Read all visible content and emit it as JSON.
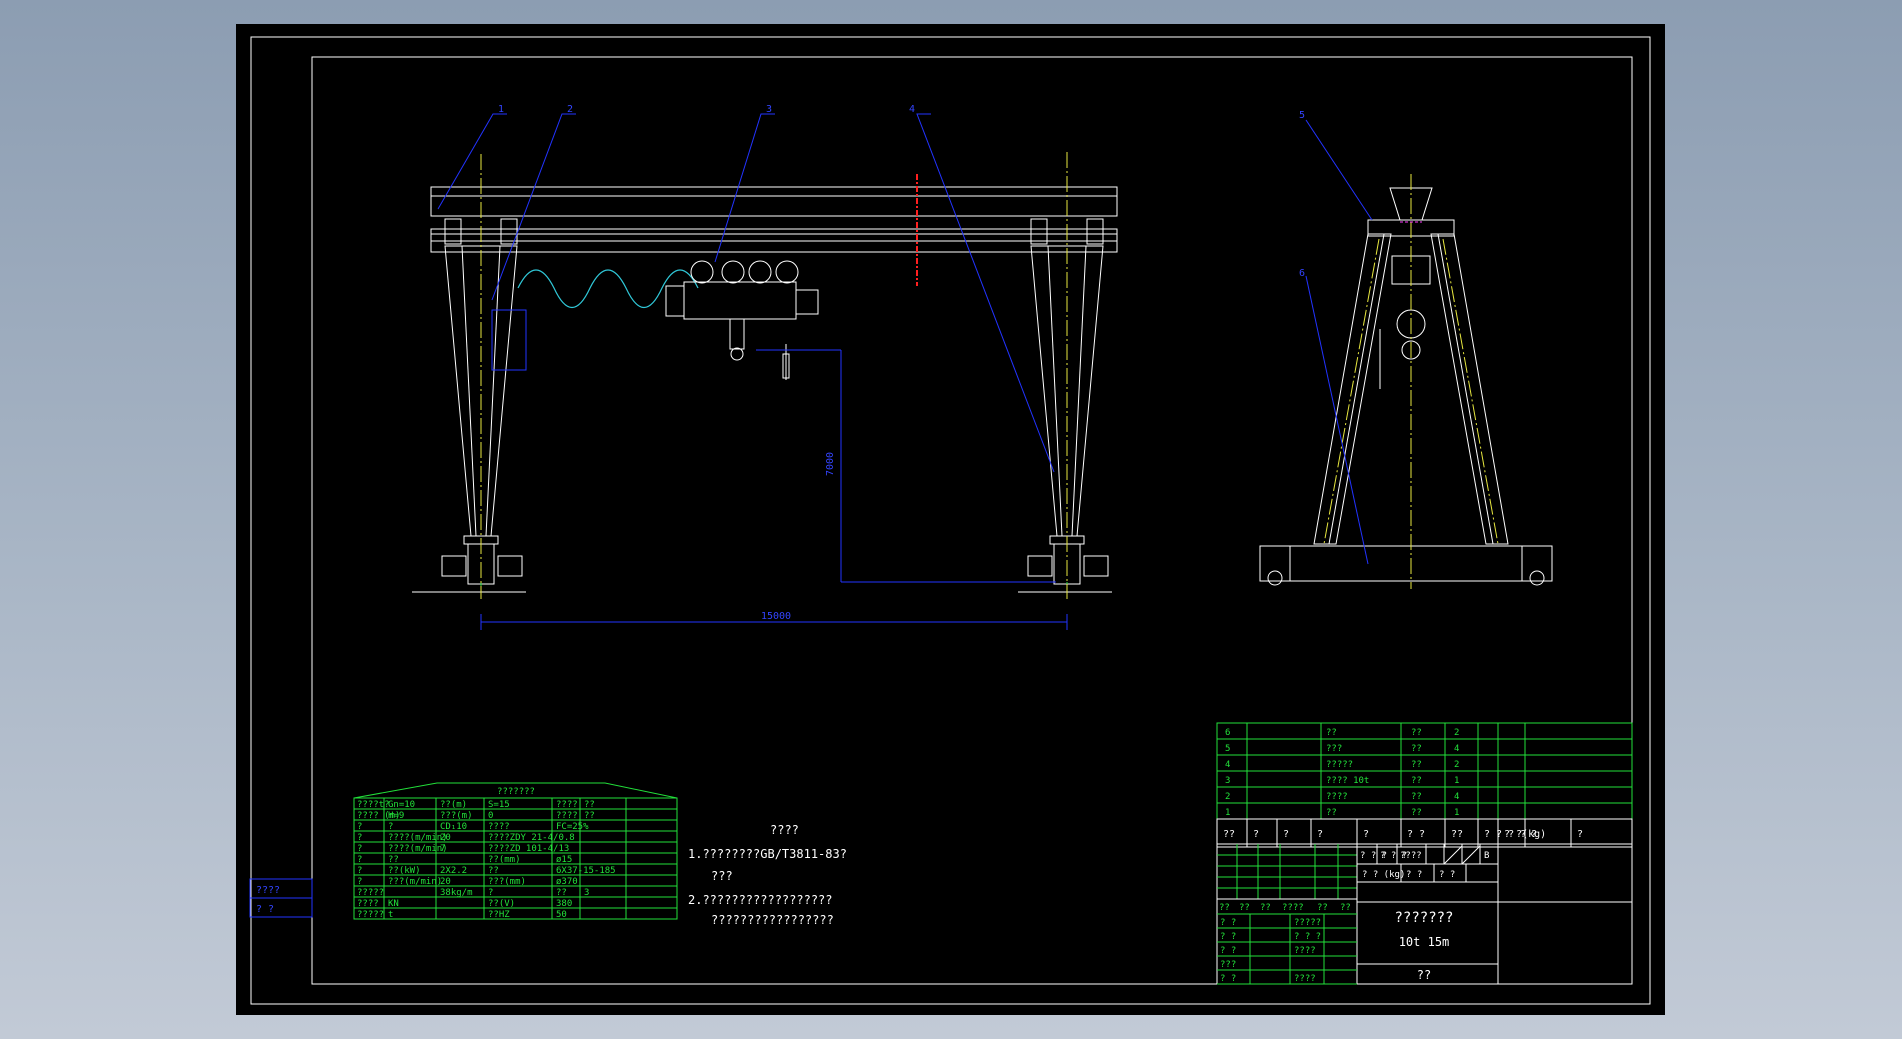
{
  "drawing": {
    "part_numbers": [
      "1",
      "2",
      "3",
      "4",
      "5",
      "6"
    ],
    "dim_span": "15000",
    "dim_height": "7000"
  },
  "notes": {
    "heading": "????",
    "line1": "1.????????GB/T3811-83?",
    "line2": "???",
    "line3": "2.??????????????????",
    "line4": "?????????????????"
  },
  "spec_table": {
    "title": "???????",
    "rows": [
      [
        "????t?",
        "Gn=10",
        "??(m)",
        "S=15",
        "????",
        "??"
      ],
      [
        "???? (m)",
        "H=9",
        "???(m)",
        "0",
        "????",
        "??"
      ],
      [
        "?",
        "?",
        "CD₁10",
        "????",
        "FC=25%",
        ""
      ],
      [
        "?",
        "????(m/min)",
        "20",
        "????ZDY 21-4/0.8",
        "",
        ""
      ],
      [
        "?",
        "????(m/min)",
        "7",
        "????ZD 101-4/13",
        "",
        ""
      ],
      [
        "?",
        "??",
        "",
        "??(mm)",
        "ø15",
        ""
      ],
      [
        "?",
        "??(kW)",
        "2X2.2",
        "??",
        "6X37-15-185",
        ""
      ],
      [
        "?",
        "???(m/min)",
        "20",
        "???(mm)",
        "ø370",
        ""
      ],
      [
        "?????",
        "",
        "38kg/m",
        "?",
        "??",
        "3"
      ],
      [
        "????",
        "KN",
        "",
        "??(V)",
        "380",
        ""
      ],
      [
        "?????",
        "t",
        "",
        "??HZ",
        "50",
        ""
      ]
    ]
  },
  "left_stamp": {
    "a": "????",
    "b": "?   ?"
  },
  "parts_list": [
    {
      "no": "6",
      "name": "??",
      "qty": "??",
      "n": "2"
    },
    {
      "no": "5",
      "name": "???",
      "qty": "??",
      "n": "4"
    },
    {
      "no": "4",
      "name": "?????",
      "qty": "??",
      "n": "2"
    },
    {
      "no": "3",
      "name": "???? 10t",
      "qty": "??",
      "n": "1"
    },
    {
      "no": "2",
      "name": "????",
      "qty": "??",
      "n": "4"
    },
    {
      "no": "1",
      "name": "??",
      "qty": "??",
      "n": "1"
    }
  ],
  "parts_header": [
    "??",
    "?",
    "?",
    "?",
    "?",
    "? ?",
    "??",
    "? ? ? ?",
    "? ?(kg)",
    "?",
    "?"
  ],
  "title_block": {
    "name": "???????",
    "spec": "10t    15m",
    "company": "??",
    "scale_cells": [
      "? ? ?",
      "? ? ?",
      "????",
      "B"
    ],
    "weight_cells": [
      "? ? (kg)",
      "? ?",
      "? ?"
    ],
    "sign_header": [
      "??",
      "??",
      "??",
      "????",
      "??",
      "??"
    ],
    "sign_rows": [
      "? ?",
      "? ?",
      "? ?",
      "???",
      "? ?"
    ],
    "sign_cells": [
      "?????",
      "? ? ?",
      "????",
      "",
      "????"
    ]
  }
}
